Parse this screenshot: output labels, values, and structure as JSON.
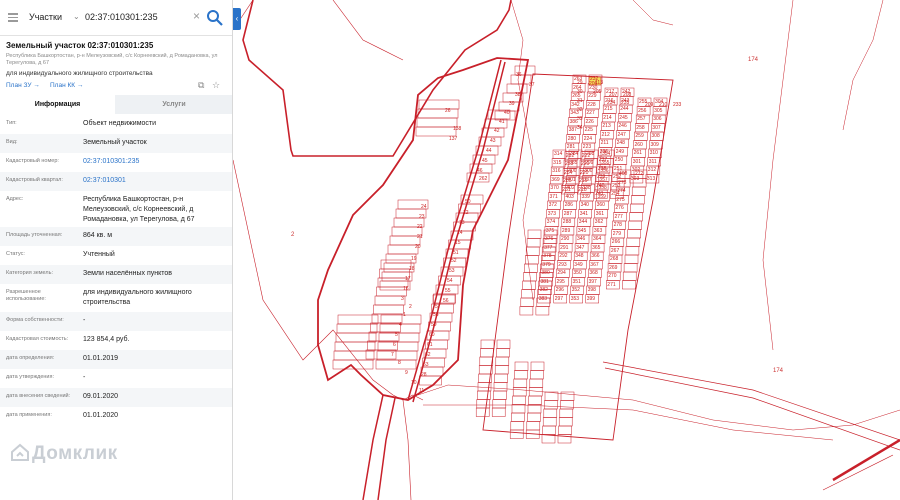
{
  "search": {
    "type": "Участки",
    "value": "02:37:010301:235"
  },
  "object": {
    "title": "Земельный участок 02:37:010301:235",
    "address_short": "Республика Башкортостан, р-н Мелеузовский, с/с Корнеевский, д Ромадановка, ул Терегулова, д 67",
    "purpose": "для индивидуального жилищного строительства",
    "plan_zu": "План ЗУ →",
    "plan_kk": "План КК →"
  },
  "tabs": {
    "info": "Информация",
    "services": "Услуги"
  },
  "fields": [
    {
      "label": "Тип:",
      "value": "Объект недвижимости",
      "link": false
    },
    {
      "label": "Вид:",
      "value": "Земельный участок",
      "link": false
    },
    {
      "label": "Кадастровый номер:",
      "value": "02:37:010301:235",
      "link": true
    },
    {
      "label": "Кадастровый квартал:",
      "value": "02:37:010301",
      "link": true
    },
    {
      "label": "Адрес:",
      "value": "Республика Башкортостан, р-н Мелеузовский, с/с Корнеевский, д Ромадановка, ул Терегулова, д 67",
      "link": false
    },
    {
      "label": "Площадь уточненная:",
      "value": "864 кв. м",
      "link": false
    },
    {
      "label": "Статус:",
      "value": "Учтенный",
      "link": false
    },
    {
      "label": "Категория земель:",
      "value": "Земли населённых пунктов",
      "link": false
    },
    {
      "label": "Разрешенное использование:",
      "value": "для индивидуального жилищного строительства",
      "link": false
    },
    {
      "label": "Форма собственности:",
      "value": "-",
      "link": false
    },
    {
      "label": "Кадастровая стоимость:",
      "value": "123 854,4 руб.",
      "link": false
    },
    {
      "label": "дата определения:",
      "value": "01.01.2019",
      "link": false
    },
    {
      "label": "дата утверждения:",
      "value": "-",
      "link": false
    },
    {
      "label": "дата внесения сведений:",
      "value": "09.01.2020",
      "link": false
    },
    {
      "label": "дата применения:",
      "value": "01.01.2020",
      "link": false
    }
  ],
  "watermark": "Домклик",
  "map": {
    "labels": [
      "174",
      "2",
      "174"
    ],
    "highlight_plot": "235",
    "plot_numbers": [
      "36",
      "37",
      "38",
      "39",
      "40",
      "41",
      "42",
      "43",
      "44",
      "45",
      "46",
      "26",
      "138",
      "137",
      "262",
      "50",
      "24",
      "23",
      "22",
      "21",
      "20",
      "19",
      "18",
      "17",
      "16",
      "3",
      "2",
      "1",
      "4",
      "5",
      "6",
      "7",
      "8",
      "9",
      "10",
      "11",
      "12",
      "13",
      "14",
      "15",
      "51",
      "52",
      "53",
      "54",
      "55",
      "56",
      "57",
      "58",
      "59",
      "60",
      "61",
      "62",
      "63",
      "28",
      "29",
      "30",
      "31",
      "32",
      "33",
      "34",
      "113",
      "205",
      "206",
      "207",
      "208",
      "209",
      "210",
      "233",
      "234",
      "235",
      "263",
      "264",
      "265",
      "342",
      "343",
      "386",
      "387",
      "280",
      "281",
      "282",
      "283",
      "284",
      "285",
      "231",
      "232",
      "230",
      "229",
      "228",
      "227",
      "226",
      "225",
      "224",
      "223",
      "222",
      "221",
      "220",
      "219",
      "218",
      "217",
      "216",
      "215",
      "214",
      "213",
      "212",
      "211",
      "236",
      "237",
      "238",
      "239",
      "240",
      "241",
      "242",
      "243",
      "244",
      "245",
      "246",
      "247",
      "248",
      "249",
      "250",
      "251",
      "252",
      "253",
      "254",
      "255",
      "256",
      "257",
      "258",
      "259",
      "260",
      "261",
      "301",
      "302",
      "303",
      "304",
      "305",
      "306",
      "307",
      "308",
      "309",
      "310",
      "311",
      "312",
      "313",
      "314",
      "315",
      "316",
      "369",
      "370",
      "371",
      "372",
      "373",
      "374",
      "375",
      "376",
      "377",
      "378",
      "379",
      "380",
      "381",
      "382",
      "383",
      "384",
      "385",
      "400",
      "401",
      "402",
      "403",
      "286",
      "287",
      "288",
      "289",
      "290",
      "291",
      "292",
      "293",
      "294",
      "295",
      "296",
      "297",
      "298",
      "299",
      "300",
      "337",
      "338",
      "339",
      "340",
      "341",
      "344",
      "345",
      "346",
      "347",
      "348",
      "349",
      "350",
      "351",
      "352",
      "353",
      "354",
      "355",
      "356",
      "357",
      "358",
      "359",
      "360",
      "361",
      "362",
      "363",
      "364",
      "365",
      "366",
      "367",
      "368",
      "397",
      "398",
      "399",
      "400",
      "273",
      "274",
      "275",
      "276",
      "277",
      "278",
      "279",
      "266",
      "267",
      "268",
      "269",
      "270",
      "271",
      "272"
    ]
  }
}
